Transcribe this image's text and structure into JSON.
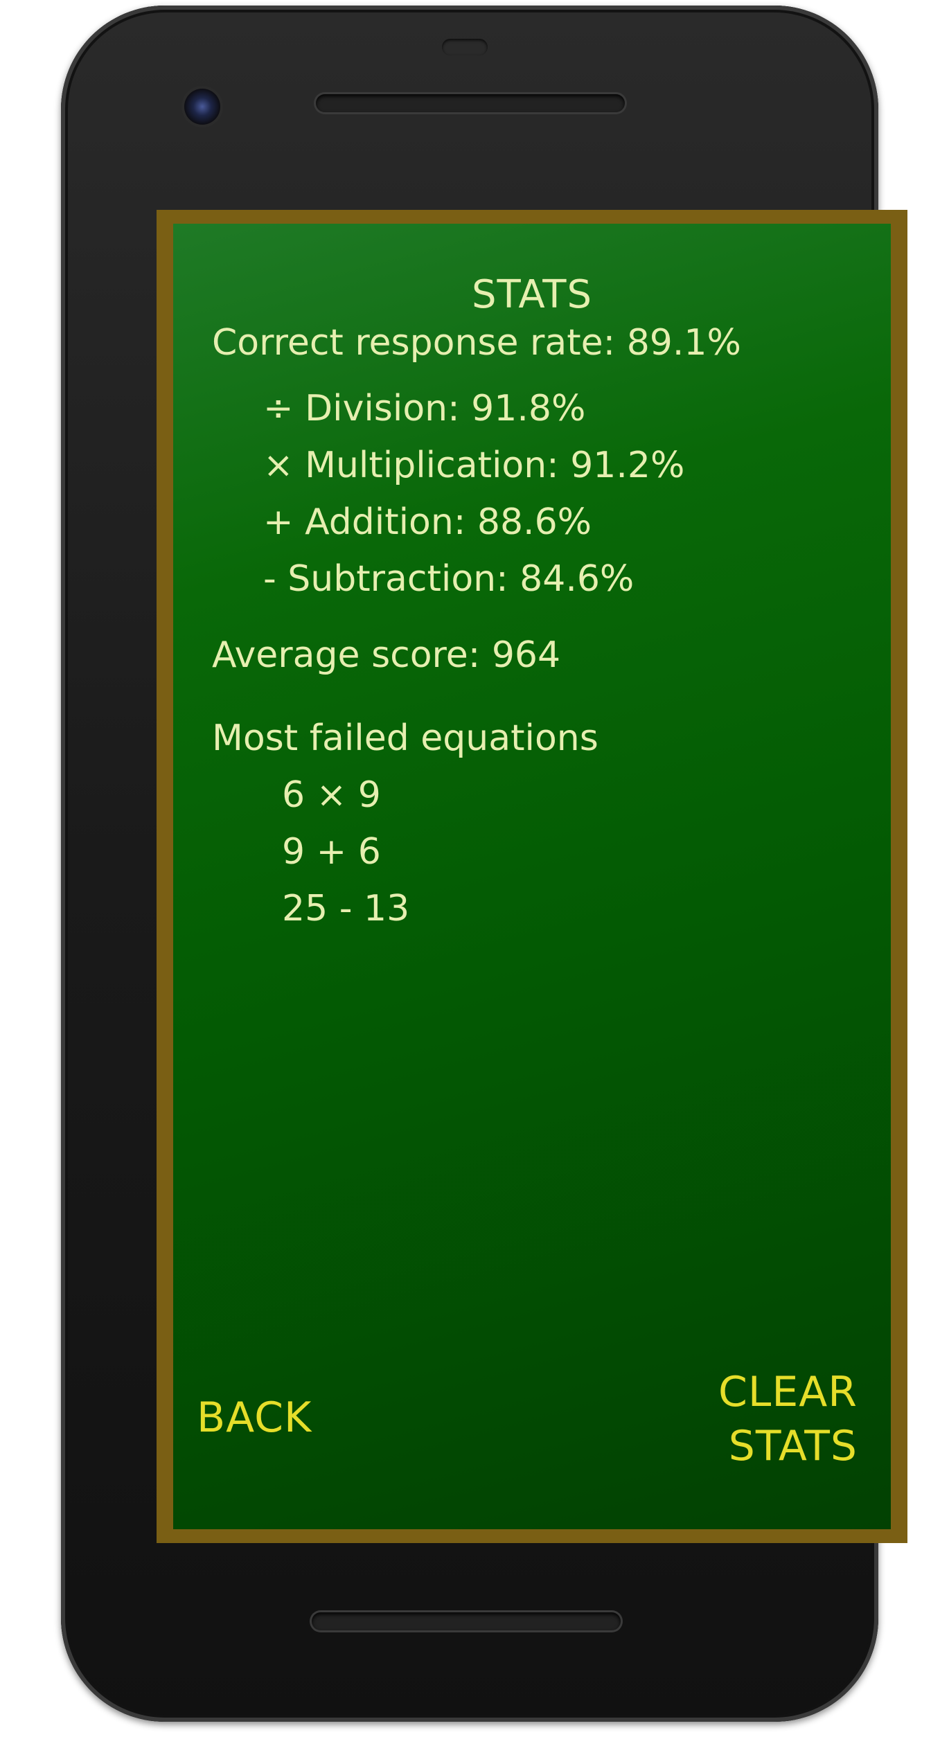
{
  "app": {
    "title": "STATS"
  },
  "stats": {
    "correct_rate_label": "Correct response rate: 89.1%",
    "operations": [
      {
        "text": "÷ Division: 91.8%"
      },
      {
        "text": "× Multiplication: 91.2%"
      },
      {
        "text": "+ Addition: 88.6%"
      },
      {
        "text": "- Subtraction: 84.6%"
      }
    ],
    "average_score_label": "Average score: 964",
    "failed_header": "Most failed equations",
    "failed_equations": [
      "6 × 9",
      "9 + 6",
      "25 - 13"
    ]
  },
  "actions": {
    "back_label": "BACK",
    "clear_label_line1": "CLEAR",
    "clear_label_line2": "STATS"
  },
  "colors": {
    "board_top": "#1f7a26",
    "board_bottom": "#024102",
    "frame": "#7a5f14",
    "chalk_text": "#e6efb0",
    "action_text": "#e6de2a",
    "phone_body": "#1a1a1a"
  }
}
